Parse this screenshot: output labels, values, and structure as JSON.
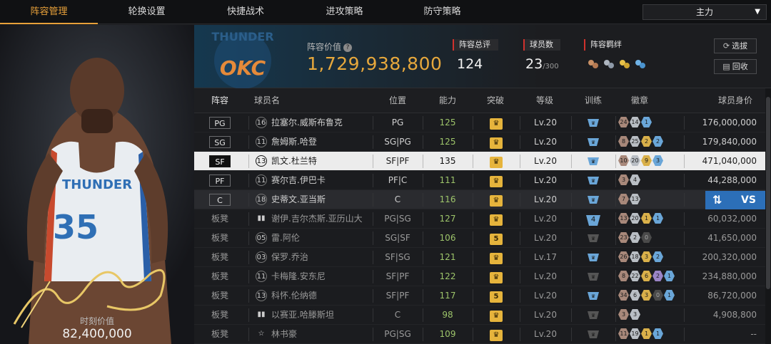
{
  "nav": {
    "tabs": [
      {
        "label": "阵容管理",
        "active": true
      },
      {
        "label": "轮换设置",
        "active": false
      },
      {
        "label": "快捷战术",
        "active": false
      },
      {
        "label": "进攻策略",
        "active": false
      },
      {
        "label": "防守策略",
        "active": false
      }
    ],
    "lineup_select": "主力"
  },
  "portrait": {
    "moment_label": "时刻价值",
    "moment_value": "82,400,000",
    "jersey_text": "THUNDER",
    "jersey_number": "35"
  },
  "header": {
    "team_logo_text": "OKC",
    "team_logo_top": "THUNDER",
    "lineup_value_label": "阵容价值",
    "lineup_value": "1,729,938,800",
    "rating_label": "阵容总评",
    "rating_value": "124",
    "players_label": "球员数",
    "players_value": "23",
    "players_max": "/300",
    "chemistry_label": "阵容羁绊",
    "buttons": {
      "select": "选拔",
      "recycle": "回收"
    }
  },
  "table": {
    "headers": [
      "阵容",
      "球员名",
      "位置",
      "能力",
      "突破",
      "等级",
      "训练",
      "徽章",
      "球员身价"
    ],
    "rows": [
      {
        "slot": "PG",
        "jersey": "16",
        "name": "拉塞尔.威斯布鲁克",
        "position": "PG",
        "ability": "125",
        "breakthrough": "crown",
        "level": "Lv.20",
        "training": "blue",
        "training_num": "",
        "badges": [
          [
            "24",
            "bronze"
          ],
          [
            "14",
            "silver"
          ],
          [
            "1",
            "blue"
          ]
        ],
        "salary": "176,000,000"
      },
      {
        "slot": "SG",
        "jersey": "11",
        "name": "詹姆斯.哈登",
        "position": "SG|PG",
        "ability": "125",
        "breakthrough": "crown",
        "level": "Lv.20",
        "training": "blue",
        "training_num": "",
        "badges": [
          [
            "8",
            "bronze"
          ],
          [
            "25",
            "silver"
          ],
          [
            "2",
            "gold"
          ],
          [
            "2",
            "blue"
          ]
        ],
        "salary": "179,840,000"
      },
      {
        "slot": "SF",
        "jersey": "13",
        "name": "凯文.杜兰特",
        "position": "SF|PF",
        "ability": "135",
        "breakthrough": "crown",
        "level": "Lv.20",
        "training": "blue",
        "training_num": "",
        "badges": [
          [
            "10",
            "bronze"
          ],
          [
            "20",
            "silver"
          ],
          [
            "9",
            "gold"
          ],
          [
            "3",
            "blue"
          ]
        ],
        "salary": "471,040,000",
        "selected": true
      },
      {
        "slot": "PF",
        "jersey": "11",
        "name": "赛尔吉.伊巴卡",
        "position": "PF|C",
        "ability": "111",
        "breakthrough": "crown",
        "level": "Lv.20",
        "training": "blue",
        "training_num": "",
        "badges": [
          [
            "3",
            "bronze"
          ],
          [
            "4",
            "silver"
          ]
        ],
        "salary": "44,288,000"
      },
      {
        "slot": "C",
        "jersey": "18",
        "name": "史蒂文.亚当斯",
        "position": "C",
        "ability": "116",
        "breakthrough": "crown",
        "level": "Lv.20",
        "training": "blue",
        "training_num": "",
        "badges": [
          [
            "7",
            "bronze"
          ],
          [
            "13",
            "silver"
          ]
        ],
        "salary": "",
        "dark": true
      },
      {
        "slot": "板凳",
        "jersey": "il",
        "name": "谢伊.吉尔杰斯.亚历山大",
        "position": "PG|SG",
        "ability": "127",
        "breakthrough": "crown",
        "level": "Lv.20",
        "training": "blue",
        "training_num": "4",
        "badges": [
          [
            "13",
            "bronze"
          ],
          [
            "20",
            "silver"
          ],
          [
            "1",
            "gold"
          ],
          [
            "1",
            "blue"
          ]
        ],
        "salary": "60,032,000"
      },
      {
        "slot": "板凳",
        "jersey": "05",
        "name": "雷.阿伦",
        "position": "SG|SF",
        "ability": "106",
        "breakthrough": "5",
        "level": "Lv.20",
        "training": "gray",
        "training_num": "",
        "badges": [
          [
            "23",
            "bronze"
          ],
          [
            "2",
            "silver"
          ],
          [
            "0",
            "dark"
          ]
        ],
        "salary": "41,650,000"
      },
      {
        "slot": "板凳",
        "jersey": "03",
        "name": "保罗.乔治",
        "position": "SF|SG",
        "ability": "121",
        "breakthrough": "crown",
        "level": "Lv.17",
        "training": "blue",
        "training_num": "",
        "badges": [
          [
            "26",
            "bronze"
          ],
          [
            "18",
            "silver"
          ],
          [
            "3",
            "gold"
          ],
          [
            "2",
            "blue"
          ]
        ],
        "salary": "200,320,000"
      },
      {
        "slot": "板凳",
        "jersey": "11",
        "name": "卡梅隆.安东尼",
        "position": "SF|PF",
        "ability": "122",
        "breakthrough": "crown",
        "level": "Lv.20",
        "training": "gray",
        "training_num": "",
        "badges": [
          [
            "8",
            "bronze"
          ],
          [
            "22",
            "silver"
          ],
          [
            "6",
            "gold"
          ],
          [
            "2",
            "purple"
          ],
          [
            "1",
            "blue"
          ]
        ],
        "salary": "234,880,000"
      },
      {
        "slot": "板凳",
        "jersey": "13",
        "name": "科怀.伦纳德",
        "position": "SF|PF",
        "ability": "117",
        "breakthrough": "5",
        "level": "Lv.20",
        "training": "blue",
        "training_num": "",
        "badges": [
          [
            "34",
            "bronze"
          ],
          [
            "6",
            "silver"
          ],
          [
            "3",
            "gold"
          ],
          [
            "0",
            "dark"
          ],
          [
            "1",
            "blue"
          ]
        ],
        "salary": "86,720,000"
      },
      {
        "slot": "板凳",
        "jersey": "il",
        "name": "以赛亚.哈滕斯坦",
        "position": "C",
        "ability": "98",
        "breakthrough": "crown",
        "level": "Lv.20",
        "training": "gray",
        "training_num": "",
        "badges": [
          [
            "3",
            "bronze"
          ],
          [
            "3",
            "silver"
          ]
        ],
        "salary": "4,908,800"
      },
      {
        "slot": "板凳",
        "jersey": "star",
        "name": "林书豪",
        "position": "PG|SG",
        "ability": "109",
        "breakthrough": "crown",
        "level": "Lv.20",
        "training": "gray",
        "training_num": "",
        "badges": [
          [
            "11",
            "bronze"
          ],
          [
            "19",
            "silver"
          ],
          [
            "1",
            "gold"
          ],
          [
            "1",
            "blue"
          ]
        ],
        "salary": "--"
      }
    ]
  },
  "vs_button": {
    "swap_icon": "⇅",
    "label": "VS"
  },
  "colors": {
    "accent": "#e8a13a",
    "ability": "#9dc46a",
    "value": "#e7a83c",
    "vs": "#2c6fb8"
  }
}
